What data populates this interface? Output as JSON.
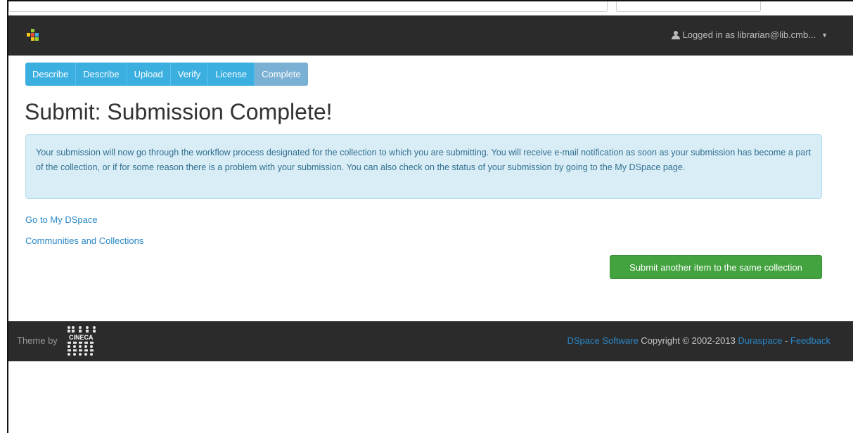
{
  "navbar": {
    "user_label": "Logged in as librarian@lib.cmb...",
    "logo_icon": "dspace-logo-icon",
    "user_icon": "user-icon",
    "caret_icon": "caret-down-icon"
  },
  "steps": [
    "Describe",
    "Describe",
    "Upload",
    "Verify",
    "License",
    "Complete"
  ],
  "active_step": "Complete",
  "page": {
    "title": "Submit: Submission Complete!",
    "info_message": "Your submission will now go through the workflow process designated for the collection to which you are submitting. You will receive e-mail notification as soon as your submission has become a part of the collection, or if for some reason there is a problem with your submission. You can also check on the status of your submission by going to the My DSpace page.",
    "link_mydspace": "Go to My DSpace",
    "link_communities": "Communities and Collections",
    "submit_another": "Submit another item to the same collection"
  },
  "footer": {
    "theme_by": "Theme by",
    "cineca_logo_text": "CINECA",
    "dspace_software": "DSpace Software",
    "copyright": " Copyright © 2002-2013 ",
    "duraspace": "Duraspace",
    "separator": " - ",
    "feedback": "Feedback"
  },
  "colors": {
    "navbar_bg": "#2b2b2b",
    "step_bg": "#3aafe0",
    "step_active_bg": "#7ab0d3",
    "alert_bg": "#d9edf7",
    "alert_text": "#31708f",
    "link": "#2a87c7",
    "success_button": "#43a33f"
  }
}
